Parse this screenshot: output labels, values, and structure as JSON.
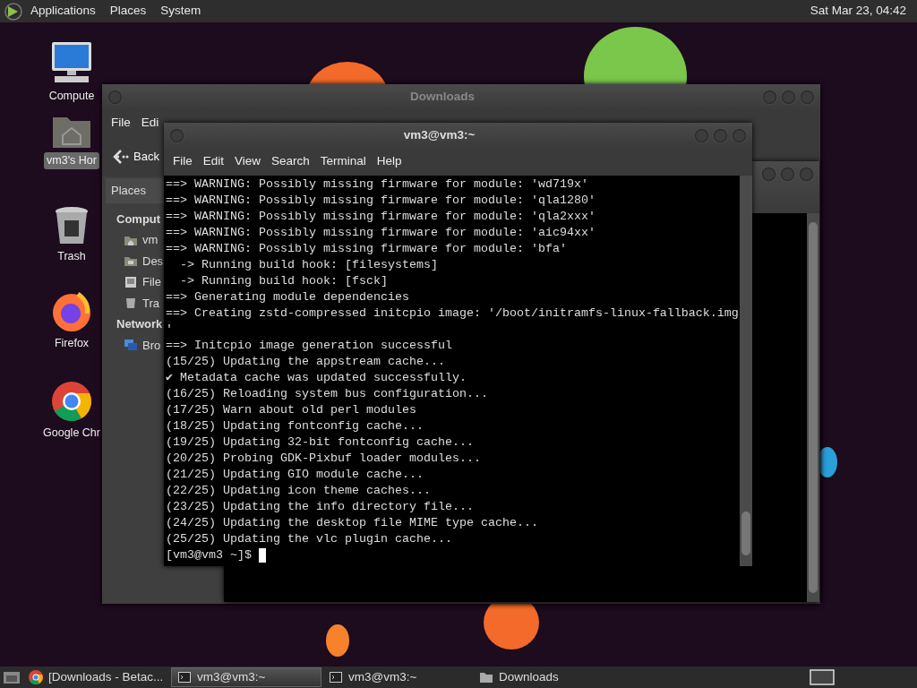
{
  "top_panel": {
    "menus": [
      "Applications",
      "Places",
      "System"
    ],
    "clock": "Sat Mar 23, 04:42"
  },
  "desktop_icons": [
    {
      "label": "Compute",
      "kind": "computer",
      "selected": false
    },
    {
      "label": "vm3's Hor",
      "kind": "home",
      "selected": true
    },
    {
      "label": "Trash",
      "kind": "trash",
      "selected": false
    },
    {
      "label": "Firefox",
      "kind": "firefox",
      "selected": false
    },
    {
      "label": "Google Chr",
      "kind": "chrome",
      "selected": false
    }
  ],
  "file_manager": {
    "title": "Downloads",
    "menus": [
      "File",
      "Edi"
    ],
    "back_button": "Back",
    "sidebar": {
      "header": "Places",
      "sections": [
        {
          "heading": "Comput",
          "items": [
            {
              "label": "vm",
              "kind": "home"
            },
            {
              "label": "Des",
              "kind": "desktop"
            },
            {
              "label": "File",
              "kind": "drive"
            },
            {
              "label": "Tra",
              "kind": "trash"
            }
          ]
        },
        {
          "heading": "Network",
          "items": [
            {
              "label": "Bro",
              "kind": "network"
            }
          ]
        }
      ]
    }
  },
  "terminal": {
    "title": "vm3@vm3:~",
    "menus": [
      "File",
      "Edit",
      "View",
      "Search",
      "Terminal",
      "Help"
    ],
    "lines": [
      "==> WARNING: Possibly missing firmware for module: 'wd719x'",
      "==> WARNING: Possibly missing firmware for module: 'qla1280'",
      "==> WARNING: Possibly missing firmware for module: 'qla2xxx'",
      "==> WARNING: Possibly missing firmware for module: 'aic94xx'",
      "==> WARNING: Possibly missing firmware for module: 'bfa'",
      "  -> Running build hook: [filesystems]",
      "  -> Running build hook: [fsck]",
      "==> Generating module dependencies",
      "==> Creating zstd-compressed initcpio image: '/boot/initramfs-linux-fallback.img",
      "'",
      "==> Initcpio image generation successful",
      "(15/25) Updating the appstream cache...",
      "✔ Metadata cache was updated successfully.",
      "(16/25) Reloading system bus configuration...",
      "(17/25) Warn about old perl modules",
      "(18/25) Updating fontconfig cache...",
      "(19/25) Updating 32-bit fontconfig cache...",
      "(20/25) Probing GDK-Pixbuf loader modules...",
      "(21/25) Updating GIO module cache...",
      "(22/25) Updating icon theme caches...",
      "(23/25) Updating the info directory file...",
      "(24/25) Updating the desktop file MIME type cache...",
      "(25/25) Updating the vlc plugin cache..."
    ],
    "prompt": "[vm3@vm3 ~]$"
  },
  "taskbar": [
    {
      "label": "[Downloads - Betac...",
      "kind": "browser",
      "selected": false
    },
    {
      "label": "vm3@vm3:~",
      "kind": "terminal",
      "selected": true
    },
    {
      "label": "vm3@vm3:~",
      "kind": "terminal",
      "selected": false
    },
    {
      "label": "Downloads",
      "kind": "folder",
      "selected": false
    }
  ]
}
